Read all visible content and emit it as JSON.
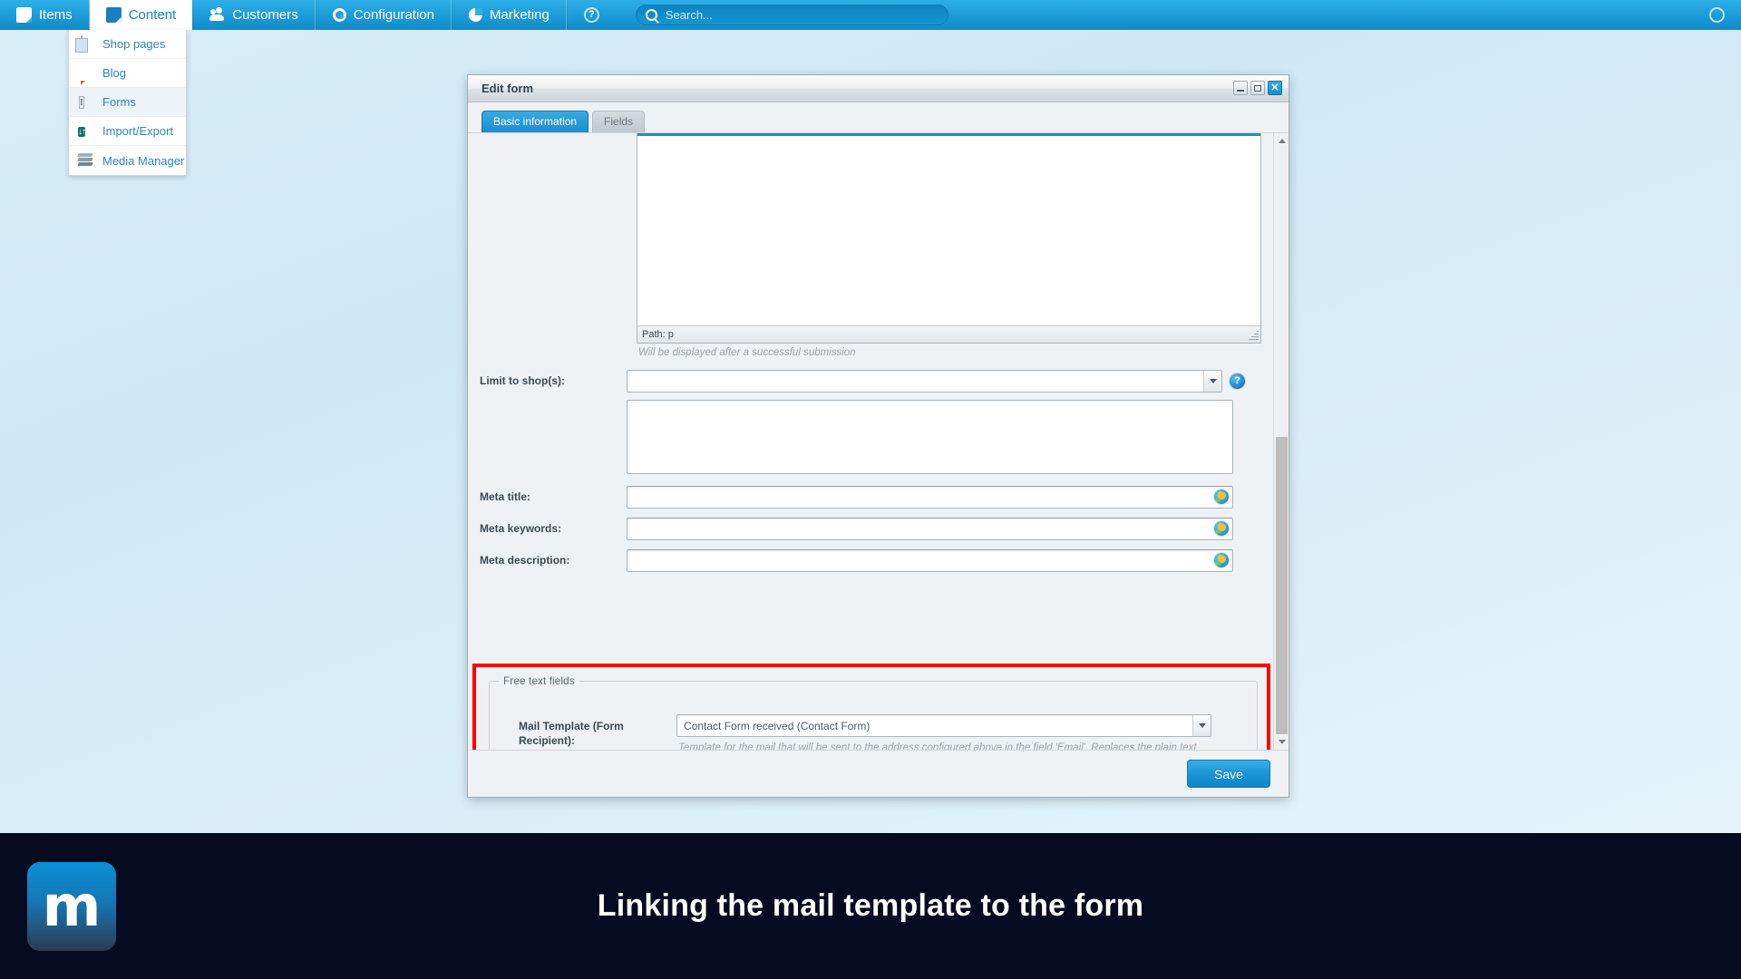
{
  "topnav": {
    "items": [
      {
        "label": "Items",
        "icon": "box-icon",
        "active": false
      },
      {
        "label": "Content",
        "icon": "page-icon",
        "active": true
      },
      {
        "label": "Customers",
        "icon": "users-icon",
        "active": false
      },
      {
        "label": "Configuration",
        "icon": "gear-icon",
        "active": false
      },
      {
        "label": "Marketing",
        "icon": "pie-chart-icon",
        "active": false
      },
      {
        "label": "",
        "icon": "help-circle-icon",
        "active": false
      }
    ],
    "search": {
      "placeholder": "Search...",
      "value": "",
      "icon": "search-icon"
    }
  },
  "content_menu": {
    "items": [
      {
        "label": "Shop pages",
        "icon": "pages-icon",
        "selected": false
      },
      {
        "label": "Blog",
        "icon": "speech-bubble-icon",
        "selected": false
      },
      {
        "label": "Forms",
        "icon": "text-cursor-icon",
        "selected": true
      },
      {
        "label": "Import/Export",
        "icon": "import-export-icon",
        "selected": false
      },
      {
        "label": "Media Manager",
        "icon": "layers-icon",
        "selected": false
      }
    ]
  },
  "dialog": {
    "title": "Edit form",
    "window_controls": {
      "minimize": "–",
      "maximize": "□",
      "close": "✕"
    },
    "tabs": [
      {
        "label": "Basic information",
        "active": true
      },
      {
        "label": "Fields",
        "active": false
      }
    ],
    "editor": {
      "status_path": "Path: p",
      "hint": "Will be displayed after a successful submission",
      "content": ""
    },
    "fields": [
      {
        "label": "Limit to shop(s):",
        "type": "combobox",
        "value": "",
        "help": "?"
      },
      {
        "label": "",
        "type": "multiselect",
        "value": ""
      },
      {
        "label": "Meta title:",
        "type": "text",
        "value": "",
        "icon": "globe-icon"
      },
      {
        "label": "Meta keywords:",
        "type": "text",
        "value": "",
        "icon": "globe-icon"
      },
      {
        "label": "Meta description:",
        "type": "text",
        "value": "",
        "icon": "globe-icon"
      }
    ],
    "free_text_fields": {
      "legend": "Free text fields",
      "mail_template": {
        "label": "Mail Template (Form Recipient):",
        "value": "Contact Form received (Contact Form)",
        "hint": "Template for the mail that will be sent to the address configured above in the field 'Email'. Replaces the plain text mail configured above in the field 'Email template'."
      }
    },
    "footer": {
      "save_label": "Save"
    },
    "highlight_color": "#ff0000"
  },
  "caption": {
    "logo_letter": "m",
    "text": "Linking the mail template to the form"
  }
}
